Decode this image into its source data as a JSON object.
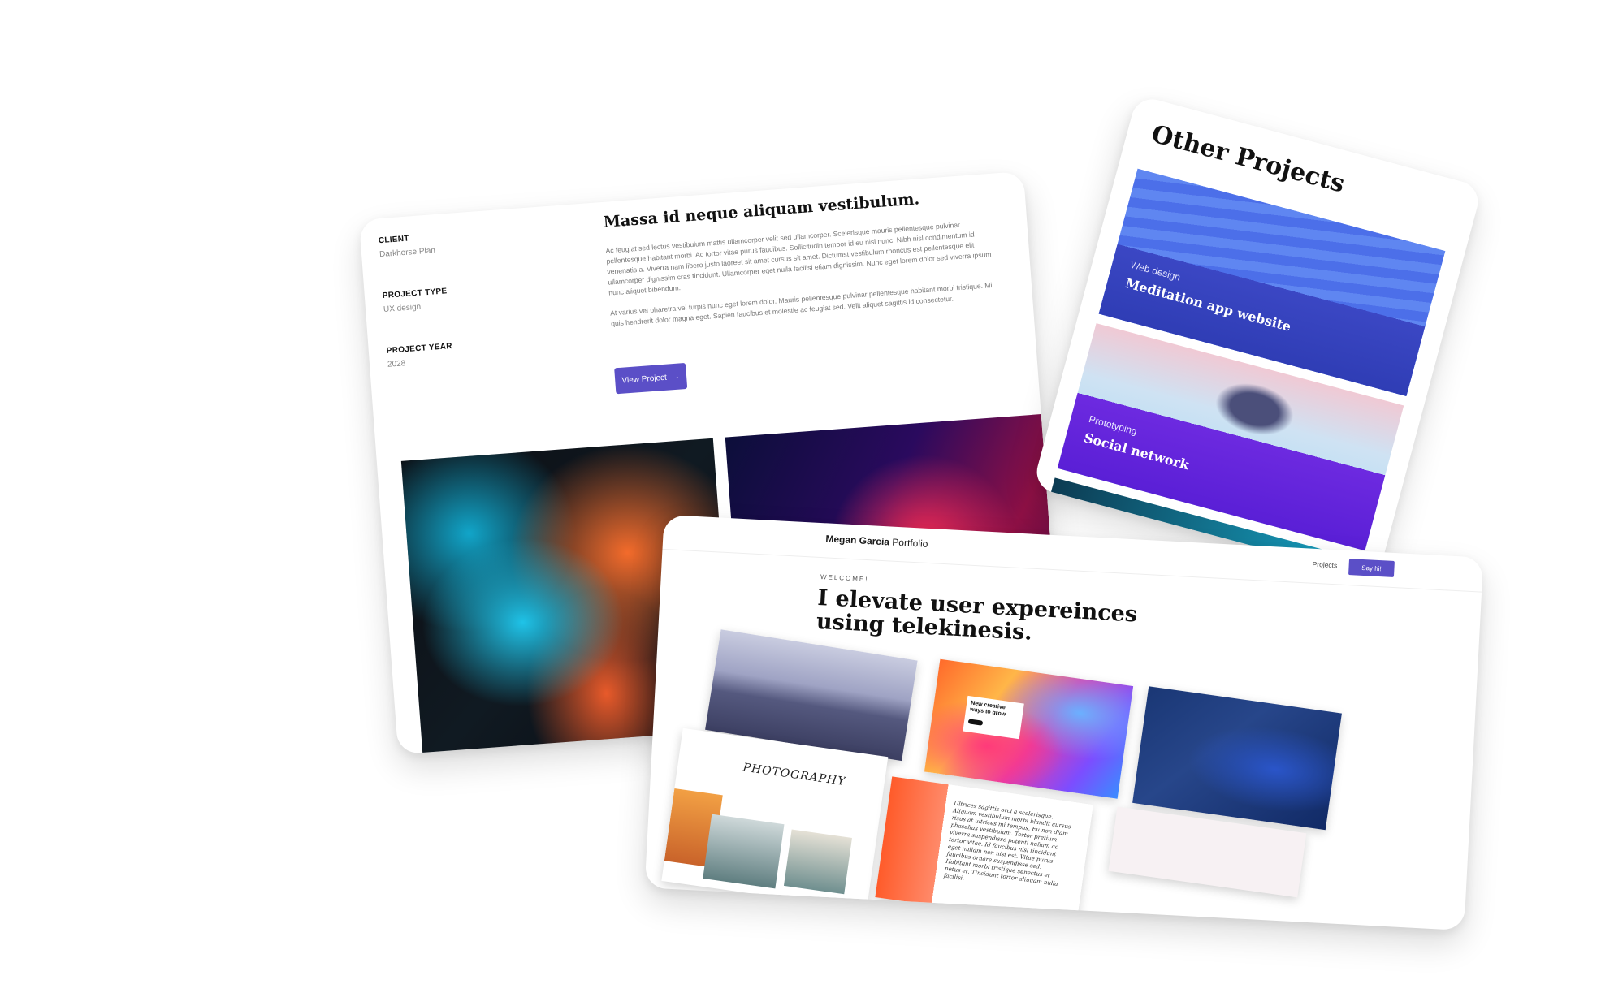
{
  "project_detail": {
    "meta": [
      {
        "label": "CLIENT",
        "value": "Darkhorse Plan"
      },
      {
        "label": "PROJECT TYPE",
        "value": "UX design"
      },
      {
        "label": "PROJECT YEAR",
        "value": "2028"
      }
    ],
    "headline": "Massa id neque aliquam vestibulum.",
    "paragraph_1": "Ac feugiat sed lectus vestibulum mattis ullamcorper velit sed ullamcorper. Scelerisque mauris pellentesque pulvinar pellentesque habitant morbi. Ac tortor vitae purus faucibus. Sollicitudin tempor id eu nisl nunc. Nibh nisl condimentum id venenatis a. Viverra nam libero justo laoreet sit amet cursus sit amet. Dictumst vestibulum rhoncus est pellentesque elit ullamcorper dignissim cras tincidunt. Ullamcorper eget nulla facilisi etiam dignissim. Nunc eget lorem dolor sed viverra ipsum nunc aliquet bibendum.",
    "paragraph_2": "At varius vel pharetra vel turpis nunc eget lorem dolor. Mauris pellentesque pulvinar pellentesque habitant morbi tristique. Mi quis hendrerit dolor magna eget. Sapien faucibus et molestie ac feugiat sed. Velit aliquet sagittis id consectetur.",
    "view_button": "View Project",
    "view_button_icon": "arrow-right-icon"
  },
  "other_projects": {
    "title": "Other Projects",
    "items": [
      {
        "category": "Web design",
        "name": "Meditation app website"
      },
      {
        "category": "Prototyping",
        "name": "Social network"
      }
    ]
  },
  "portfolio": {
    "brand_bold": "Megan Garcia",
    "brand_rest": "Portfolio",
    "nav_projects": "Projects",
    "say_hi": "Say hi!",
    "welcome": "WELCOME!",
    "hero": "I elevate user expereinces using telekinesis.",
    "tile_fluid_text": "New creative ways to grow",
    "photography_title": "PHOTOGRAPHY",
    "serif_text": "Ultrices sagittis orci a scelerisque. Aliquam vestibulum morbi blandit cursus risus at ultrices mi tempus. Eu non diam phasellus vestibulum. Tortor pretium viverra suspendisse potenti nullam ac tortor vitae. Id faucibus nisl tincidunt eget nullam non nisi est. Vitae purus faucibus ornare suspendisse sed. Habitant morbi tristique senectus et netus et. Tincidunt tortor aliquam nulla facilisi."
  },
  "colors": {
    "accent": "#5b4fc7",
    "meditation_band": "#2f3db5",
    "social_band": "#5a1fd6"
  }
}
